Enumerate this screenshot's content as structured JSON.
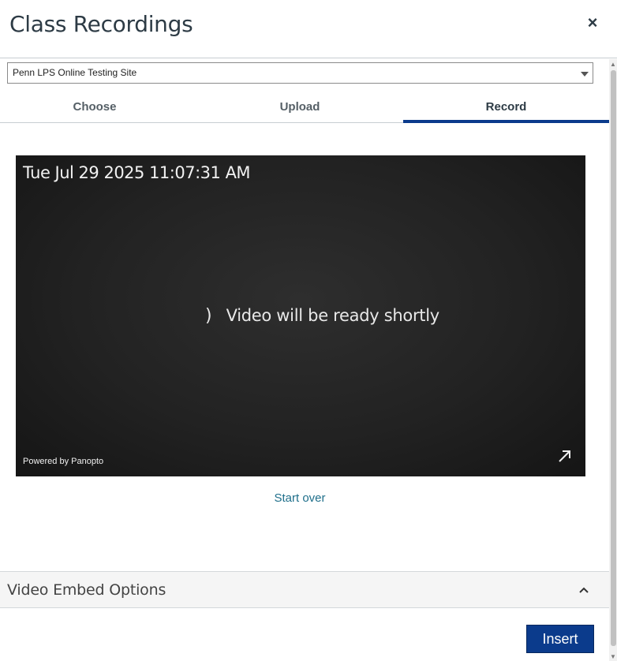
{
  "dialog": {
    "title": "Class Recordings",
    "close_label": "×"
  },
  "folder_select": {
    "value": "Penn LPS Online Testing Site"
  },
  "tabs": [
    {
      "label": "Choose",
      "active": false
    },
    {
      "label": "Upload",
      "active": false
    },
    {
      "label": "Record",
      "active": true
    }
  ],
  "player": {
    "timestamp": "Tue Jul 29 2025 11:07:31 AM",
    "spinner_glyph": ")",
    "status_text": "Video will be ready shortly",
    "powered_by": "Powered by Panopto"
  },
  "actions": {
    "start_over": "Start over",
    "insert": "Insert"
  },
  "embed_options": {
    "label": "Video Embed Options"
  },
  "icons": {
    "close": "close-icon",
    "dropdown": "chevron-down-icon",
    "expand": "expand-icon",
    "collapse": "chevron-up-icon"
  },
  "colors": {
    "accent": "#0b3b8c",
    "link": "#1f6f8b",
    "text": "#2d3b45"
  }
}
